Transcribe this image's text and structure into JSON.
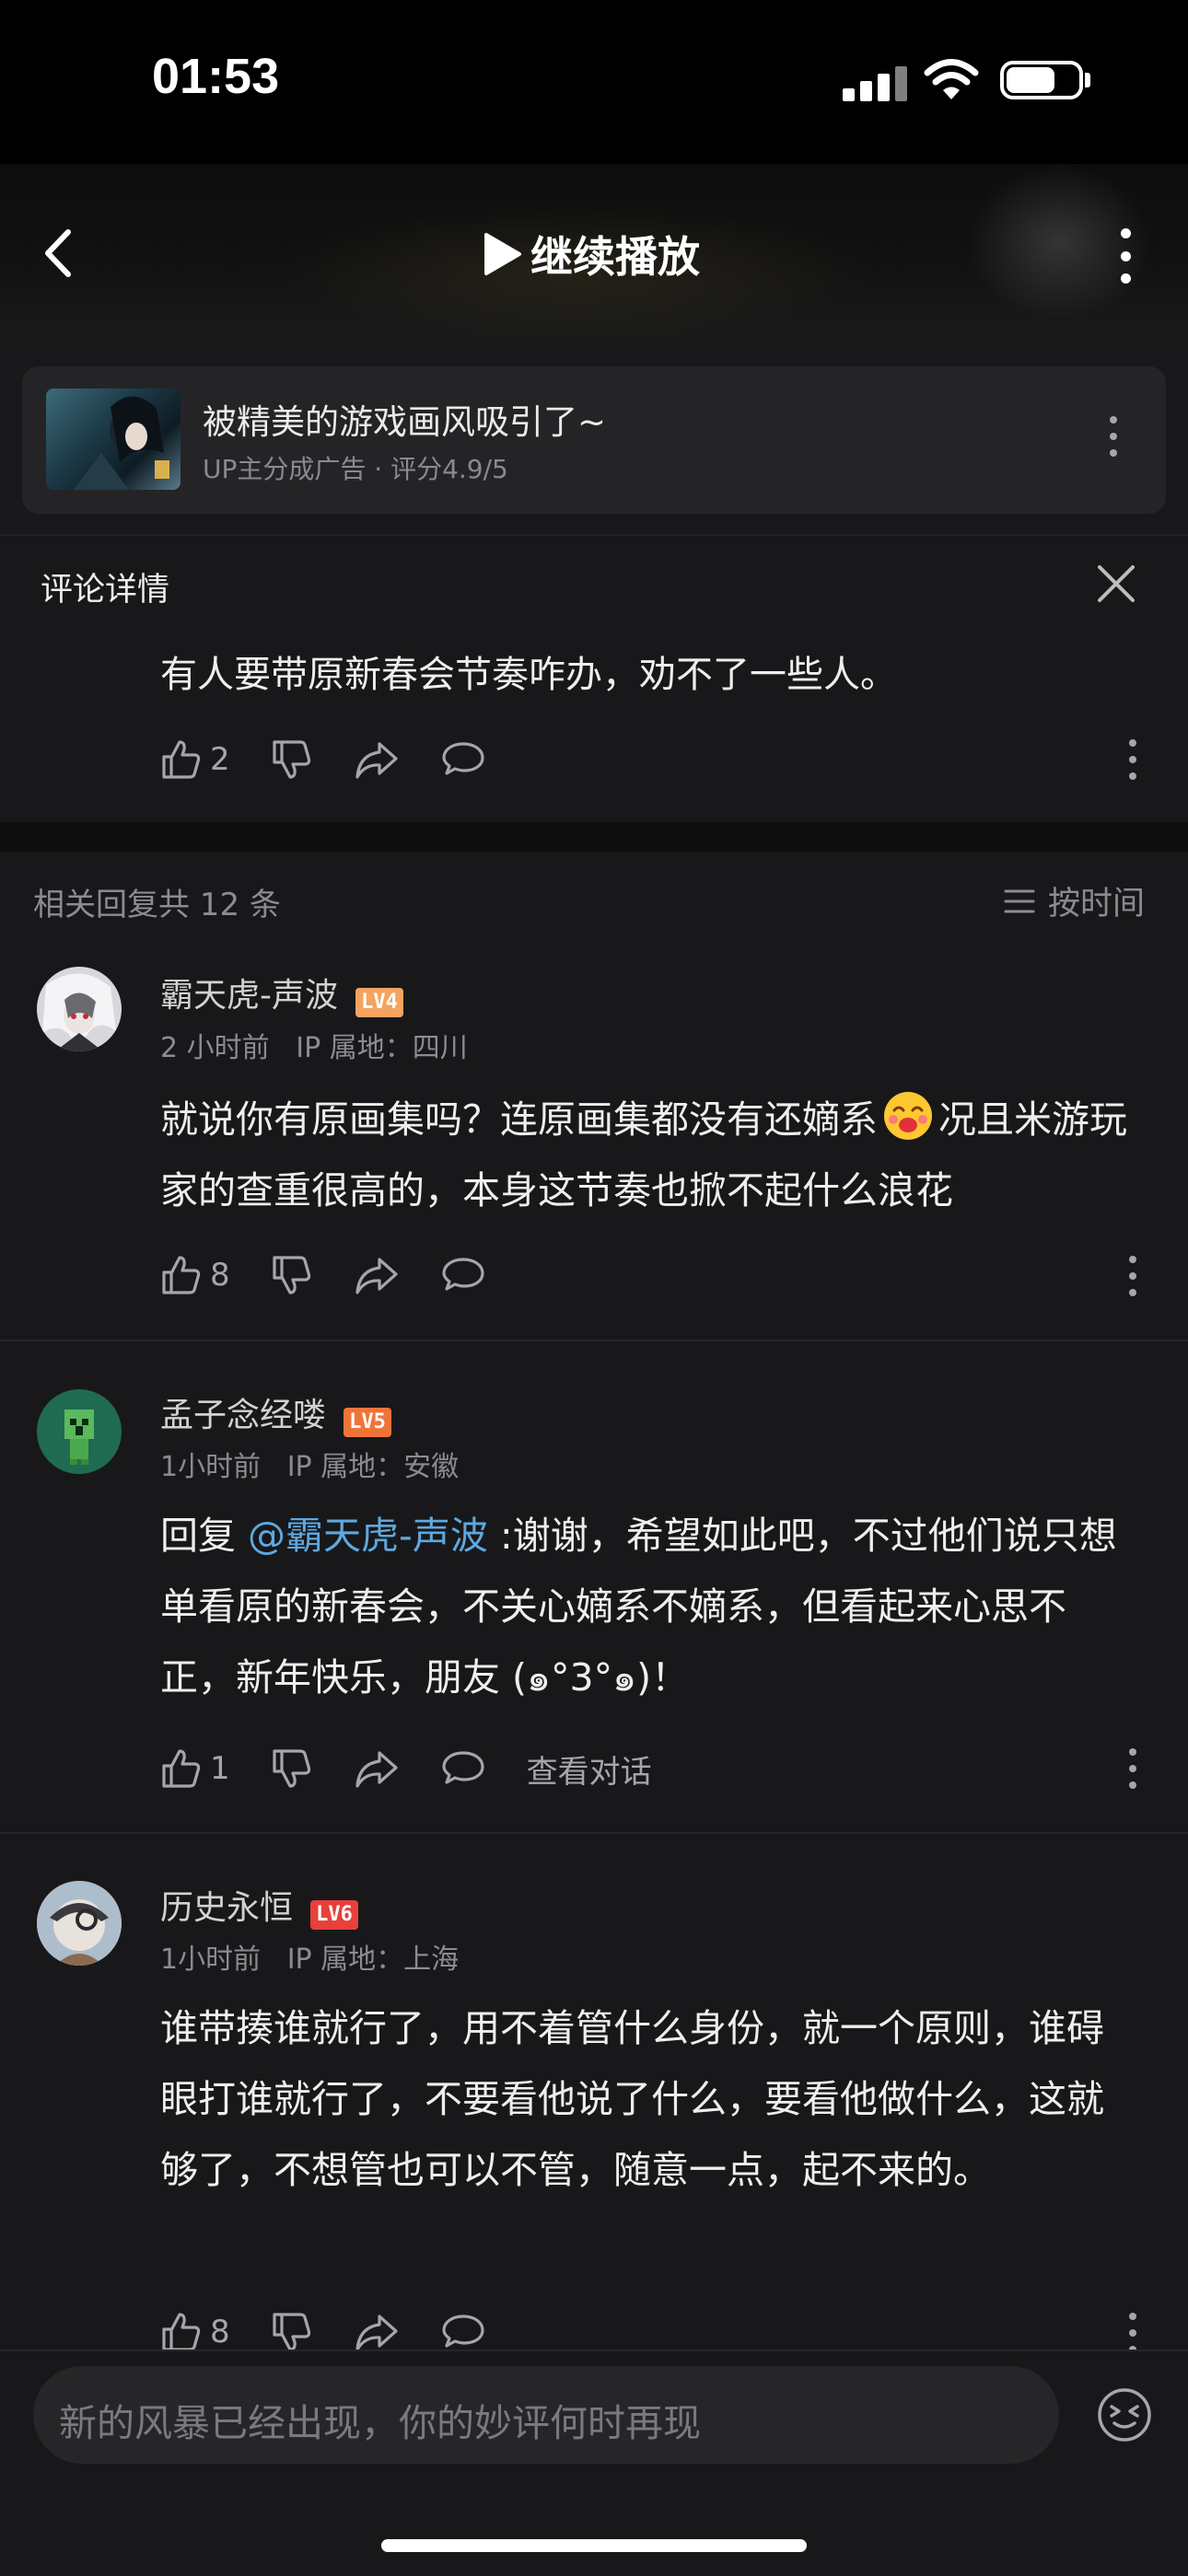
{
  "status_bar": {
    "time": "01:53"
  },
  "header": {
    "play_label": "继续播放"
  },
  "ad": {
    "title": "被精美的游戏画风吸引了~",
    "subtitle": "UP主分成广告 · 评分4.9/5"
  },
  "detail": {
    "title": "评论详情",
    "text": "有人要带原新春会节奏咋办，劝不了一些人。",
    "likes": "2"
  },
  "replies_header": {
    "count_label": "相关回复共 12 条",
    "sort_label": "按时间"
  },
  "comments": [
    {
      "username": "霸天虎-声波",
      "level": "LV4",
      "meta": "2 小时前   IP 属地：四川",
      "text_before": "就说你有原画集吗？连原画集都没有还嫡系",
      "text_after": "况且米游玩家的查重很高的，本身这节奏也掀不起什么浪花",
      "likes": "8"
    },
    {
      "username": "孟子念经喽",
      "level": "LV5",
      "meta": "1小时前   IP 属地：安徽",
      "reply_prefix": "回复 ",
      "mention": "@霸天虎-声波",
      "text": " :谢谢，希望如此吧，不过他们说只想单看原的新春会，不关心嫡系不嫡系，但看起来心思不正，新年快乐，朋友 (๑°3°๑)！",
      "likes": "1",
      "view_conversation": "查看对话"
    },
    {
      "username": "历史永恒",
      "level": "LV6",
      "meta": "1小时前   IP 属地：上海",
      "text": "谁带揍谁就行了，用不着管什么身份，就一个原则，谁碍眼打谁就行了，不要看他说了什么，要看他做什么，这就够了，不想管也可以不管，随意一点，起不来的。",
      "likes": "8"
    }
  ],
  "composer": {
    "placeholder": "新的风暴已经出现，你的妙评何时再现"
  },
  "colors": {
    "lv4": "#f4a460",
    "lv5": "#f07438",
    "lv6": "#e8403c",
    "mention": "#5ea8e0"
  }
}
